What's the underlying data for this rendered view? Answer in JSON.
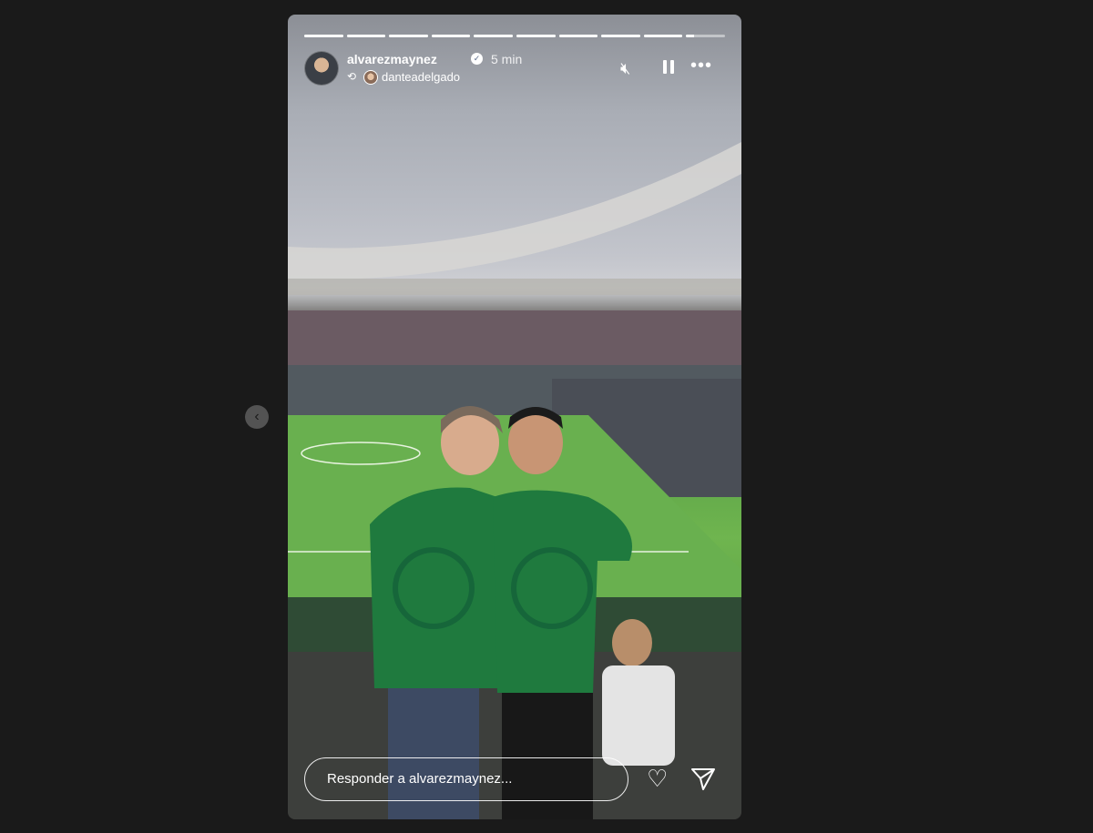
{
  "story": {
    "progress_segments": [
      1,
      1,
      1,
      1,
      1,
      1,
      1,
      1,
      1,
      0.2
    ],
    "username": "alvarezmaynez",
    "verified_icon": "verified-check-icon",
    "time_ago": "5 min",
    "reposted_from": "danteadelgado",
    "reply_placeholder": "Responder a alvarezmaynez..."
  },
  "icons": {
    "mute": "muted-speaker-icon",
    "pause": "pause-icon",
    "more": "more-options-icon",
    "like": "heart-icon",
    "share": "send-icon",
    "repost": "repost-icon",
    "prev": "chevron-left-icon"
  },
  "colors": {
    "background": "#1a1a1a",
    "jersey_green": "#1f7a3e",
    "pitch_green": "#66ad4c"
  }
}
